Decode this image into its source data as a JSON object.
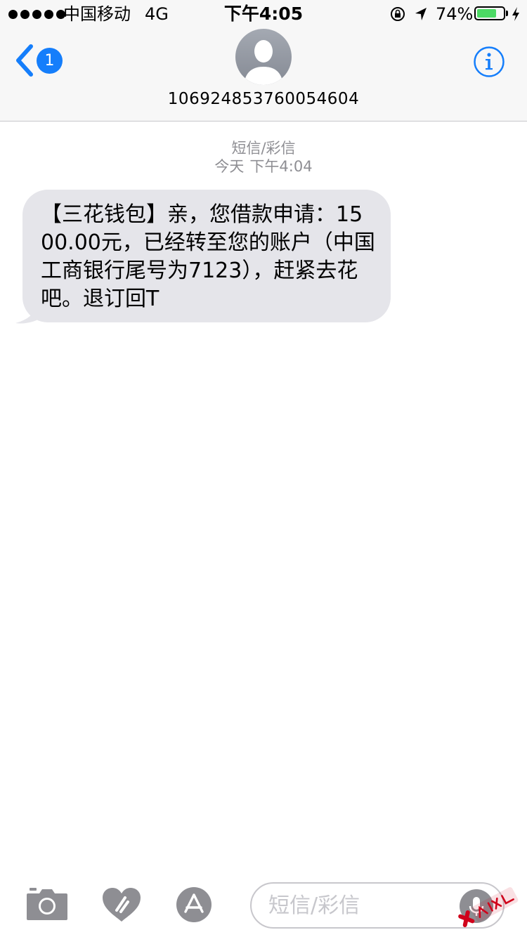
{
  "status_bar": {
    "carrier": "中国移动",
    "network": "4G",
    "time": "下午4:05",
    "battery_percent": "74%",
    "battery_level": 0.74,
    "icons": [
      "signal-dots-icon",
      "orientation-lock-icon",
      "location-arrow-icon",
      "battery-icon",
      "charging-bolt-icon"
    ]
  },
  "header": {
    "back_badge": "1",
    "contact_number": "106924853760054604",
    "icons": [
      "back-chevron-icon",
      "default-avatar-icon",
      "info-icon"
    ]
  },
  "conversation": {
    "type_label": "短信/彩信",
    "day_label": "今天",
    "time_label": "下午4:04",
    "messages": [
      {
        "direction": "incoming",
        "text": "【三花钱包】亲，您借款申请：1500.00元，已经转至您的账户（中国工商银行尾号为7123），赶紧去花吧。退订回T"
      }
    ]
  },
  "input_bar": {
    "placeholder": "短信/彩信",
    "value": "",
    "icons": [
      "camera-icon",
      "digital-touch-heart-icon",
      "app-store-icon",
      "microphone-icon"
    ]
  },
  "colors": {
    "accent": "#157efb",
    "bubble_incoming": "#e5e5ea",
    "meta_text": "#8e8e93",
    "battery_fill": "#4cd964",
    "header_bg": "#f7f7f7"
  }
}
